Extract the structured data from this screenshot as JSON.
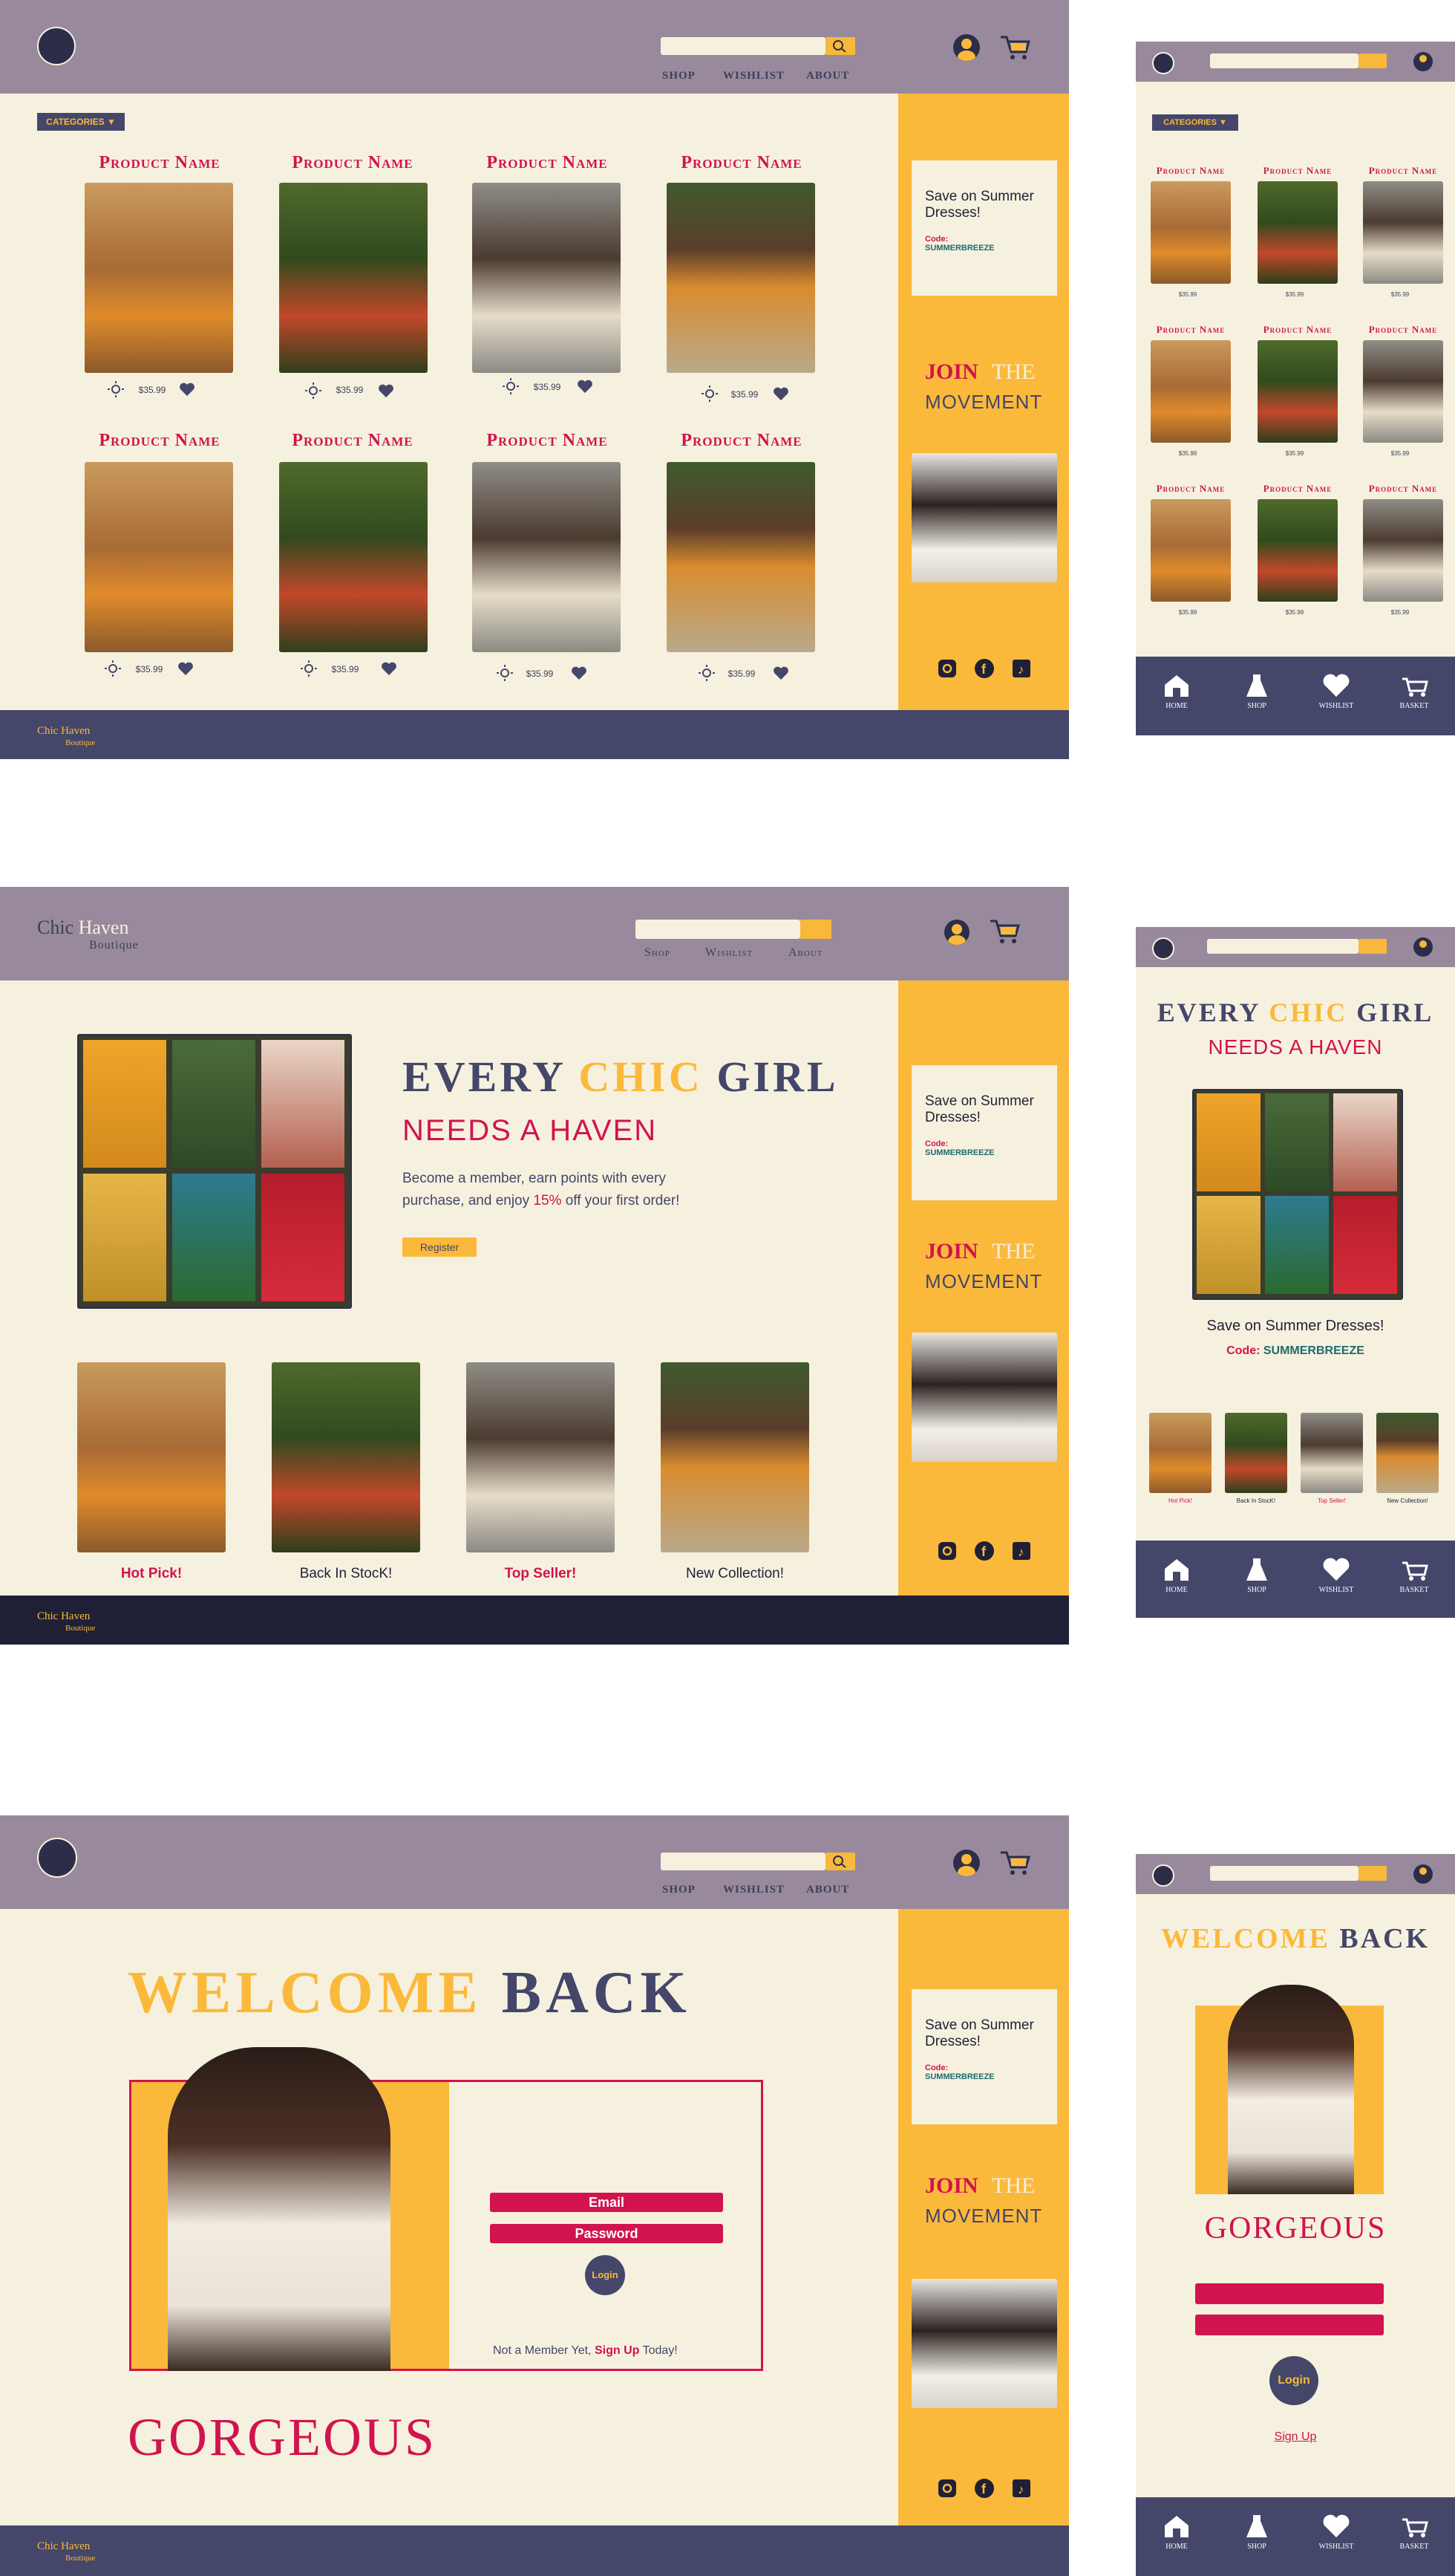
{
  "colors": {
    "header": "#988a9c",
    "cream": "#f6f1df",
    "gold": "#fbb93b",
    "navy": "#44466a",
    "crimson": "#d1134f",
    "darknavy": "#1f2036"
  },
  "brand": {
    "chic": "Chic",
    "haven": "Haven",
    "boutique": "Boutique"
  },
  "nav": {
    "shop": "SHOP",
    "wishlist": "WISHLIST",
    "about": "ABOUT",
    "shop_alt": "Shop",
    "wishlist_alt": "Wishlist",
    "about_alt": "About"
  },
  "sidebar": {
    "promo": "Save on Summer Dresses!",
    "code_label": "Code:",
    "code": "SUMMERBREEZE",
    "join": "JOIN",
    "the": "THE",
    "movement": "MOVEMENT"
  },
  "shop": {
    "categories": "CATEGORIES ▼",
    "product_name": "Product Name",
    "price": "$35.99"
  },
  "home": {
    "every": "EVERY",
    "chic": "CHIC",
    "girl": "GIRL",
    "needs": "NEEDS A HAVEN",
    "body_a": "Become a member, earn points with every",
    "body_b": "purchase, and enjoy",
    "pct": "15%",
    "body_c": "off your first order!",
    "register": "Register",
    "promo_title": "Save on Summer Dresses!",
    "tiles": [
      "Hot Pick!",
      "Back In StocK!",
      "Top Seller!",
      "New Collection!"
    ]
  },
  "login": {
    "welcome": "WELCOME",
    "back": "BACK",
    "gorgeous": "GORGEOUS",
    "email": "Email",
    "password": "Password",
    "login": "Login",
    "not_member": "Not a Member Yet,",
    "signup": "Sign Up",
    "today": "Today!",
    "signup_mobile": "Sign Up"
  },
  "mobile_nav": [
    "Home",
    "Shop",
    "Wishlist",
    "Basket"
  ],
  "icons": [
    "search-icon",
    "user-icon",
    "cart-icon",
    "instagram-icon",
    "facebook-icon",
    "tiktok-icon",
    "heart-icon",
    "home-icon",
    "dress-icon",
    "basket-icon",
    "sun-icon"
  ]
}
